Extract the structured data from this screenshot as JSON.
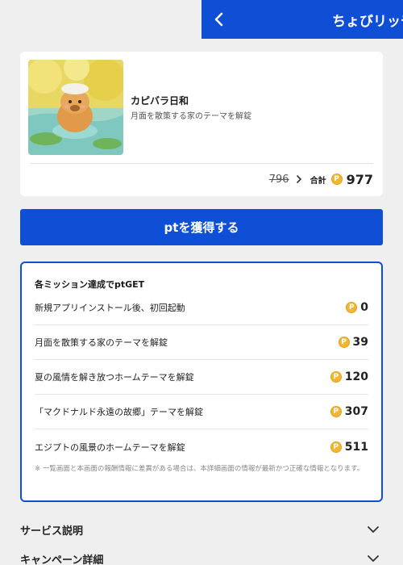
{
  "header": {
    "title": "ちょびリッチ"
  },
  "product": {
    "name": "カピバラ日和",
    "description": "月面を散策する家のテーマを解錠",
    "old_price": "796",
    "total_label": "合計",
    "total_value": "977",
    "coin_glyph": "P"
  },
  "cta": {
    "label": "ptを獲得する"
  },
  "missions": {
    "title": "各ミッション達成でptGET",
    "items": [
      {
        "label": "新規アプリインストール後、初回起動",
        "points": "0"
      },
      {
        "label": "月面を散策する家のテーマを解錠",
        "points": "39"
      },
      {
        "label": "夏の風情を解き放つホームテーマを解錠",
        "points": "120"
      },
      {
        "label": "「マクドナルド永遠の故郷」テーマを解錠",
        "points": "307"
      },
      {
        "label": "エジプトの風景のホームテーマを解錠",
        "points": "511"
      }
    ],
    "note": "※ 一覧画面と本画面の報酬情報に差異がある場合は、本詳細画面の情報が最新かつ正確な情報となります。"
  },
  "sections": [
    {
      "label": "サービス説明",
      "icon": "chevron-down-icon"
    },
    {
      "label": "キャンペーン詳細",
      "icon": "chevron-down-icon"
    }
  ],
  "colors": {
    "primary": "#0f4fd6",
    "coin": "#f2b632",
    "background": "#efefef"
  }
}
